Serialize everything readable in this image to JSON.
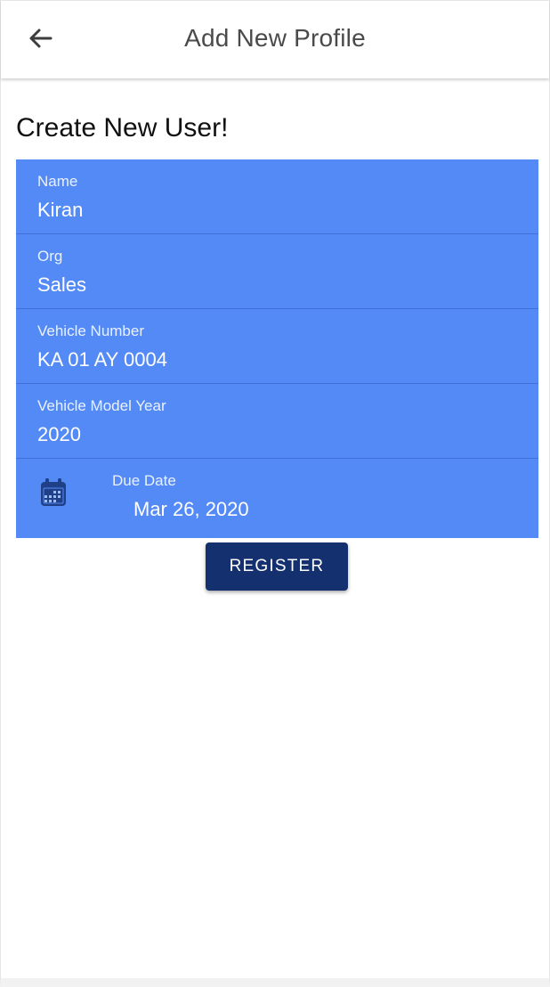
{
  "header": {
    "back_icon": "arrow-left-icon",
    "title": "Add New Profile"
  },
  "main": {
    "heading": "Create New User!",
    "form": {
      "background_color": "#548af5",
      "fields": [
        {
          "label": "Name",
          "value": "Kiran"
        },
        {
          "label": "Org",
          "value": "Sales"
        },
        {
          "label": "Vehicle Number",
          "value": "KA 01 AY 0004"
        },
        {
          "label": "Vehicle Model Year",
          "value": "2020"
        }
      ],
      "due_date": {
        "icon": "calendar-icon",
        "label": "Due Date",
        "value": "Mar 26, 2020"
      }
    },
    "register_button": {
      "label": "REGISTER",
      "color": "#14306e"
    }
  }
}
